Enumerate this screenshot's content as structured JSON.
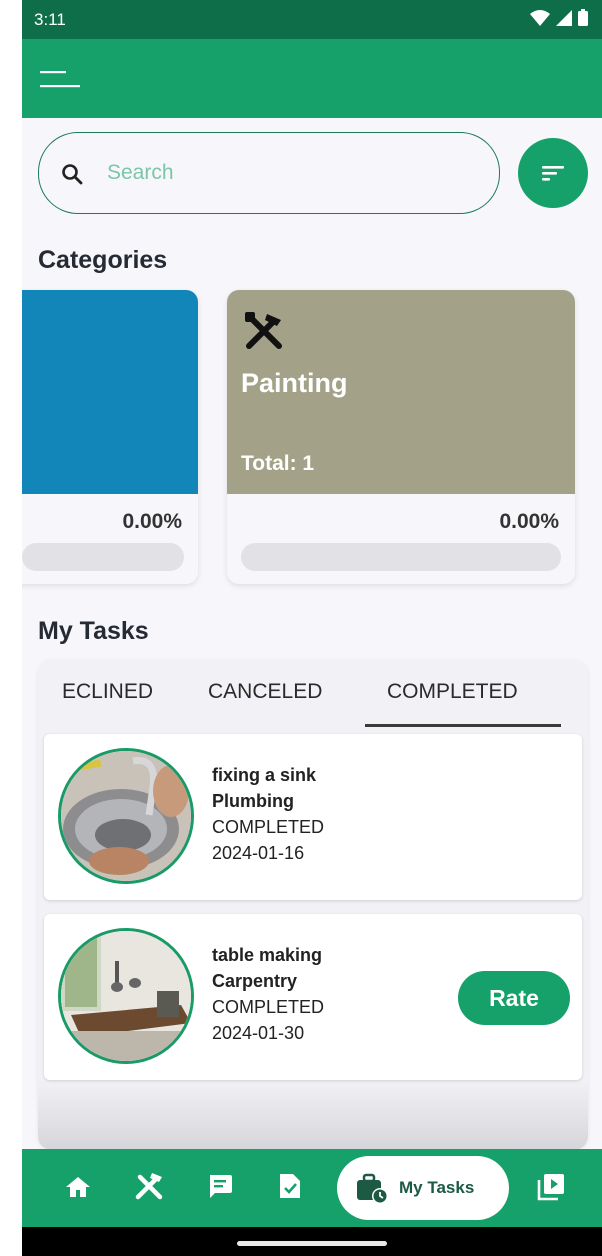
{
  "status_bar": {
    "time": "3:11"
  },
  "search": {
    "placeholder": "Search"
  },
  "sections": {
    "categories": "Categories",
    "my_tasks": "My Tasks"
  },
  "categories": [
    {
      "name": "",
      "total": "",
      "percent": "0.00%",
      "progress": 0.0,
      "color": "#1285b9"
    },
    {
      "name": "Painting",
      "total": "Total: 1",
      "percent": "0.00%",
      "progress": 0.0,
      "color": "#a3a288",
      "icon": "tools-icon"
    }
  ],
  "tabs": [
    {
      "label": "ECLINED"
    },
    {
      "label": "CANCELED"
    },
    {
      "label": "COMPLETED",
      "selected": true
    }
  ],
  "tasks": [
    {
      "title": "fixing a sink",
      "category": "Plumbing",
      "status": "COMPLETED",
      "date": "2024-01-16"
    },
    {
      "title": "table making",
      "category": "Carpentry",
      "status": "COMPLETED",
      "date": "2024-01-30",
      "action": "Rate"
    }
  ],
  "bottom_nav": {
    "items": [
      "home-icon",
      "tools-icon",
      "chat-icon",
      "document-check-icon",
      "my-tasks-icon",
      "video-library-icon"
    ],
    "active_label": "My Tasks"
  },
  "colors": {
    "primary": "#16a06a",
    "status_bar": "#0f6e4a",
    "accent_border": "#1c7a55"
  }
}
